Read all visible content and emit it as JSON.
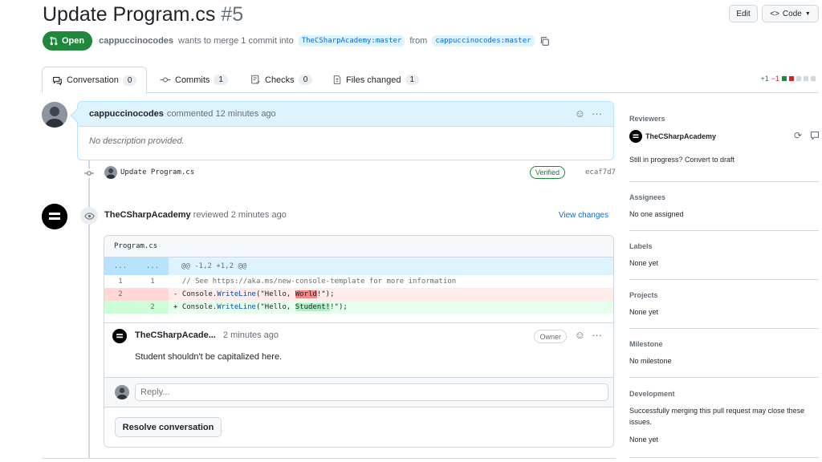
{
  "header": {
    "title": "Update Program.cs",
    "number": "#5",
    "edit_label": "Edit",
    "code_label": "Code",
    "state_label": "Open",
    "author": "cappuccinocodes",
    "merge_text": "wants to merge 1 commit into",
    "base_branch": "TheCSharpAcademy:master",
    "from_text": "from",
    "head_branch": "cappuccinocodes:master"
  },
  "tabs": [
    {
      "label": "Conversation",
      "count": "0"
    },
    {
      "label": "Commits",
      "count": "1"
    },
    {
      "label": "Checks",
      "count": "0"
    },
    {
      "label": "Files changed",
      "count": "1"
    }
  ],
  "diffstat": {
    "additions": "+1",
    "deletions": "−1"
  },
  "first_comment": {
    "author": "cappuccinocodes",
    "action": "commented 12 minutes ago",
    "body": "No description provided."
  },
  "commit": {
    "message": "Update Program.cs",
    "verified": "Verified",
    "sha": "ecaf7d7"
  },
  "review": {
    "author": "TheCSharpAcademy",
    "action": "reviewed 2 minutes ago",
    "view_changes": "View changes",
    "file": "Program.cs",
    "hunk_ln": "...",
    "hunk": "@@ -1,2 +1,2 @@",
    "line1_old": "1",
    "line1_new": "1",
    "line1_code": "  // See https://aka.ms/new-console-template for more information",
    "del_ln": "2",
    "add_ln": "2",
    "del_prefix": "- Console.",
    "del_method": "WriteLine",
    "del_open": "(\"Hello, ",
    "del_hl": "World",
    "del_close": "!\");",
    "add_prefix": "+ Console.",
    "add_method": "WriteLine",
    "add_open": "(\"Hello, ",
    "add_hl": "Student!",
    "add_close": "!\");",
    "comment_author": "TheCSharpAcade...",
    "comment_time": "2 minutes ago",
    "owner_badge": "Owner",
    "comment_body": "Student shouldn't be capitalized here.",
    "reply_placeholder": "Reply...",
    "resolve_label": "Resolve conversation"
  },
  "sidebar": {
    "reviewers_title": "Reviewers",
    "reviewer_name": "TheCSharpAcademy",
    "draft_text": "Still in progress? Convert to draft",
    "assignees_title": "Assignees",
    "assignees_value": "No one assigned",
    "labels_title": "Labels",
    "labels_value": "None yet",
    "projects_title": "Projects",
    "projects_value": "None yet",
    "milestone_title": "Milestone",
    "milestone_value": "No milestone",
    "development_title": "Development",
    "development_text1": "Successfully merging this pull request may close these",
    "development_text2": "issues.",
    "development_value": "None yet"
  },
  "colors": {
    "open_green": "#1f883d",
    "link_blue": "#0969da",
    "comment_header_bg": "#ddf4ff",
    "deleted_bg": "#ffebe9",
    "added_bg": "#e6ffec"
  }
}
